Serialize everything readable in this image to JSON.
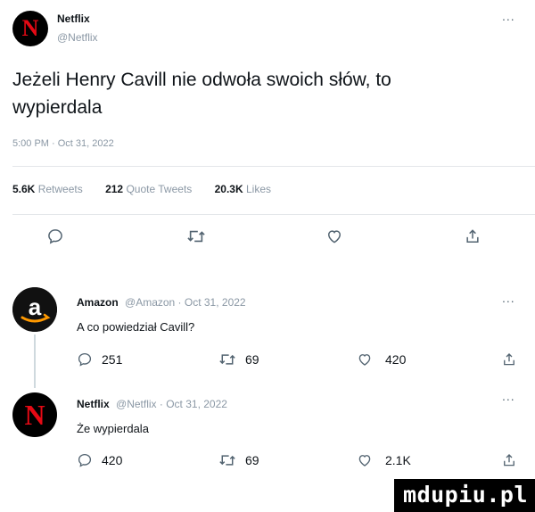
{
  "main_tweet": {
    "author_name": "Netflix",
    "author_handle": "@Netflix",
    "more_label": "...",
    "text": "Jeżeli Henry Cavill nie odwoła swoich słów, to wypierdala",
    "timestamp": "5:00 PM · Oct 31, 2022",
    "stats": {
      "retweets_count": "5.6K",
      "retweets_label": "Retweets",
      "quotes_count": "212",
      "quotes_label": "Quote Tweets",
      "likes_count": "20.3K",
      "likes_label": "Likes"
    }
  },
  "replies": [
    {
      "author_name": "Amazon",
      "meta": "@Amazon · Oct 31, 2022",
      "more_label": "...",
      "text": "A co powiedział Cavill?",
      "reply_count": "251",
      "retweet_count": "69",
      "like_count": "420"
    },
    {
      "author_name": "Netflix",
      "meta": "@Netflix · Oct 31, 2022",
      "more_label": "...",
      "text": "Że wypierdala",
      "reply_count": "420",
      "retweet_count": "69",
      "like_count": "2.1K"
    }
  ],
  "avatars": {
    "netflix_letter": "N",
    "amazon_letter": "a"
  },
  "watermark": "mdupiu.pl",
  "colors": {
    "netflix_red": "#e50914",
    "amazon_orange": "#ff9900",
    "muted": "#8b98a5"
  }
}
